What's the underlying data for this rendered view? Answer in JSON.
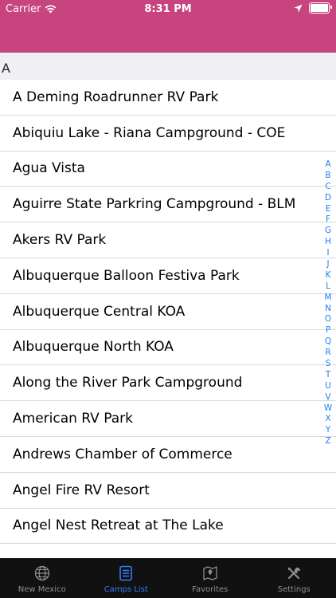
{
  "status_bar": {
    "carrier": "Carrier",
    "time": "8:31 PM"
  },
  "section": {
    "header": "A"
  },
  "camps": [
    "A Deming Roadrunner RV Park",
    "Abiquiu Lake - Riana Campground - COE",
    "Agua Vista",
    "Aguirre State Parkring Campground - BLM",
    "Akers RV Park",
    "Albuquerque Balloon Festiva Park",
    "Albuquerque Central KOA",
    "Albuquerque North KOA",
    "Along the River Park Campground",
    "American RV Park",
    "Andrews Chamber of Commerce",
    "Angel Fire RV Resort",
    "Angel Nest Retreat at The Lake"
  ],
  "index_letters": [
    "A",
    "B",
    "C",
    "D",
    "E",
    "F",
    "G",
    "H",
    "I",
    "J",
    "K",
    "L",
    "M",
    "N",
    "O",
    "P",
    "Q",
    "R",
    "S",
    "T",
    "U",
    "V",
    "W",
    "X",
    "Y",
    "Z"
  ],
  "tabs": [
    {
      "label": "New Mexico",
      "icon": "globe-icon",
      "active": false
    },
    {
      "label": "Camps List",
      "icon": "list-icon",
      "active": true
    },
    {
      "label": "Favorites",
      "icon": "map-icon",
      "active": false
    },
    {
      "label": "Settings",
      "icon": "tools-icon",
      "active": false
    }
  ],
  "colors": {
    "nav_bar": "#c8447e",
    "accent": "#2f7ef5",
    "tab_bar": "#111111"
  }
}
